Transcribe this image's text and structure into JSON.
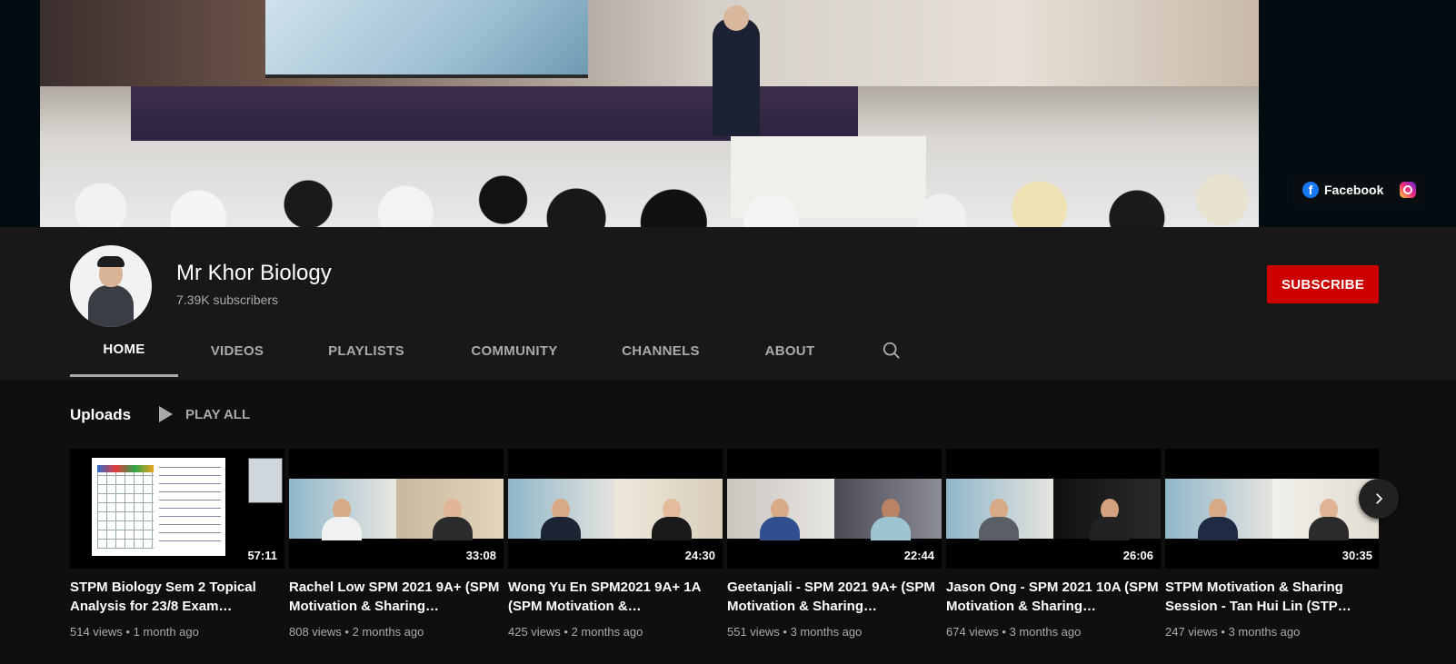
{
  "banner": {
    "links": [
      {
        "label": "Facebook",
        "icon": "facebook-icon"
      },
      {
        "label": "",
        "icon": "instagram-icon"
      }
    ]
  },
  "channel": {
    "name": "Mr Khor Biology",
    "subscribers": "7.39K subscribers",
    "subscribe_label": "SUBSCRIBE"
  },
  "tabs": [
    {
      "label": "HOME",
      "active": true
    },
    {
      "label": "VIDEOS",
      "active": false
    },
    {
      "label": "PLAYLISTS",
      "active": false
    },
    {
      "label": "COMMUNITY",
      "active": false
    },
    {
      "label": "CHANNELS",
      "active": false
    },
    {
      "label": "ABOUT",
      "active": false
    }
  ],
  "shelf": {
    "title": "Uploads",
    "play_all": "PLAY ALL",
    "videos": [
      {
        "title": "STPM Biology Sem 2 Topical Analysis for 23/8 Exam…",
        "duration": "57:11",
        "views": "514 views",
        "age": "1 month ago"
      },
      {
        "title": "Rachel Low SPM 2021 9A+ (SPM Motivation & Sharing…",
        "duration": "33:08",
        "views": "808 views",
        "age": "2 months ago"
      },
      {
        "title": "Wong Yu En SPM2021 9A+ 1A (SPM Motivation &…",
        "duration": "24:30",
        "views": "425 views",
        "age": "2 months ago"
      },
      {
        "title": "Geetanjali - SPM 2021 9A+ (SPM Motivation & Sharing…",
        "duration": "22:44",
        "views": "551 views",
        "age": "3 months ago"
      },
      {
        "title": "Jason Ong - SPM 2021 10A (SPM Motivation & Sharing…",
        "duration": "26:06",
        "views": "674 views",
        "age": "3 months ago"
      },
      {
        "title": "STPM Motivation & Sharing Session - Tan Hui Lin (STP…",
        "duration": "30:35",
        "views": "247 views",
        "age": "3 months ago"
      }
    ]
  },
  "colors": {
    "background": "#181818",
    "content_background": "#0f0f0f",
    "subscribe": "#cc0000",
    "muted_text": "#aaaaaa"
  }
}
